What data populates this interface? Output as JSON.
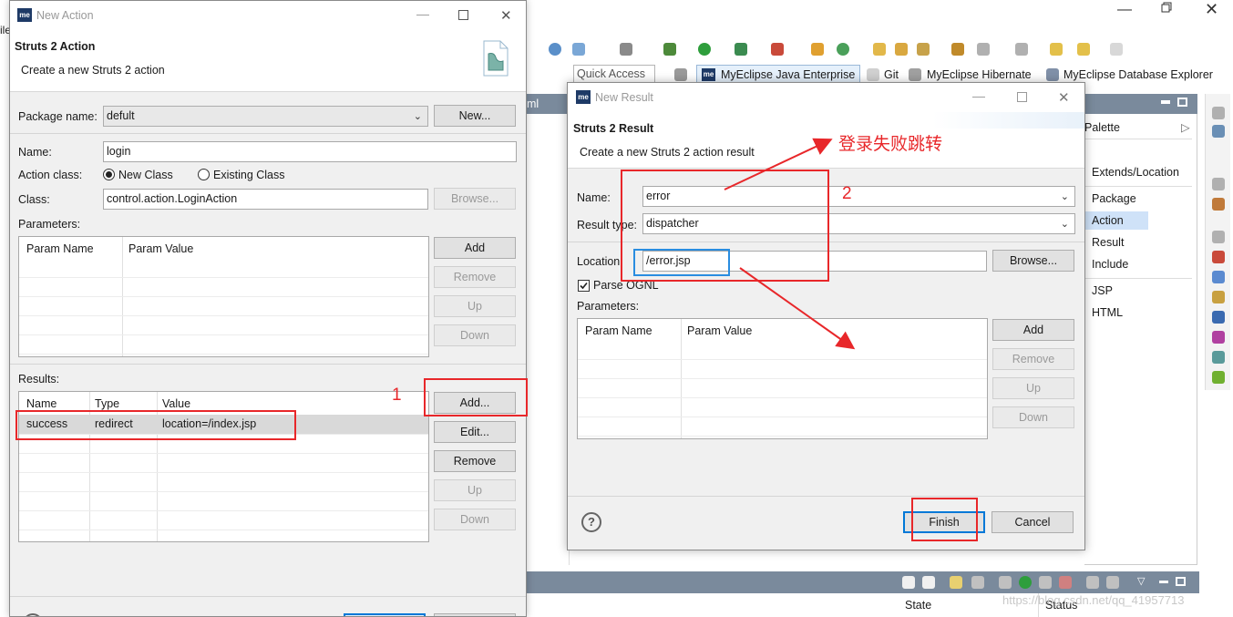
{
  "bg": {
    "toolbar_items": [
      "Quick Access",
      "MyEclipse Java Enterprise",
      "Git",
      "MyEclipse Hibernate",
      "MyEclipse Database Explorer"
    ],
    "editor_tab_fragment": "ml",
    "palette": {
      "title": "Palette",
      "items": [
        "Extends/Location",
        "Package",
        "Action",
        "Result",
        "Include",
        "JSP",
        "HTML"
      ]
    },
    "bottom_columns": [
      "State",
      "Status"
    ],
    "watermark": "https://blog.csdn.net/qq_41957713",
    "left_fragment_ile": "ile"
  },
  "dlg1": {
    "title": "New Action",
    "header_title": "Struts 2 Action",
    "header_desc": "Create a new Struts 2 action",
    "package_label": "Package name:",
    "package_value": "defult",
    "new_btn": "New...",
    "name_label": "Name:",
    "name_value": "login",
    "action_class_label": "Action class:",
    "radio_new": "New Class",
    "radio_existing": "Existing Class",
    "class_label": "Class:",
    "class_value": "control.action.LoginAction",
    "browse_btn": "Browse...",
    "params_label": "Parameters:",
    "params_cols": [
      "Param Name",
      "Param Value"
    ],
    "param_btns": {
      "add": "Add",
      "remove": "Remove",
      "up": "Up",
      "down": "Down"
    },
    "results_label": "Results:",
    "results_cols": [
      "Name",
      "Type",
      "Value"
    ],
    "results_rows": [
      {
        "name": "success",
        "type": "redirect",
        "value": "location=/index.jsp"
      }
    ],
    "result_btns": {
      "add": "Add...",
      "edit": "Edit...",
      "remove": "Remove",
      "up": "Up",
      "down": "Down"
    }
  },
  "dlg2": {
    "title": "New Result",
    "header_title": "Struts 2 Result",
    "header_desc": "Create a new Struts 2 action result",
    "name_label": "Name:",
    "name_value": "error",
    "type_label": "Result type:",
    "type_value": "dispatcher",
    "location_label": "Location:",
    "location_value": "/error.jsp",
    "browse_btn": "Browse...",
    "parse_ognl": "Parse OGNL",
    "params_label": "Parameters:",
    "params_cols": [
      "Param Name",
      "Param Value"
    ],
    "param_btns": {
      "add": "Add",
      "remove": "Remove",
      "up": "Up",
      "down": "Down"
    },
    "finish": "Finish",
    "cancel": "Cancel",
    "help": "?"
  },
  "annotations": {
    "step1": "1",
    "step2": "2",
    "note": "登录失败跳转"
  },
  "colors": {
    "accent": "#0078d7",
    "annotation_red": "#e8272a",
    "annotation_blue": "#2a8de0",
    "selection": "#d9d9d9"
  }
}
